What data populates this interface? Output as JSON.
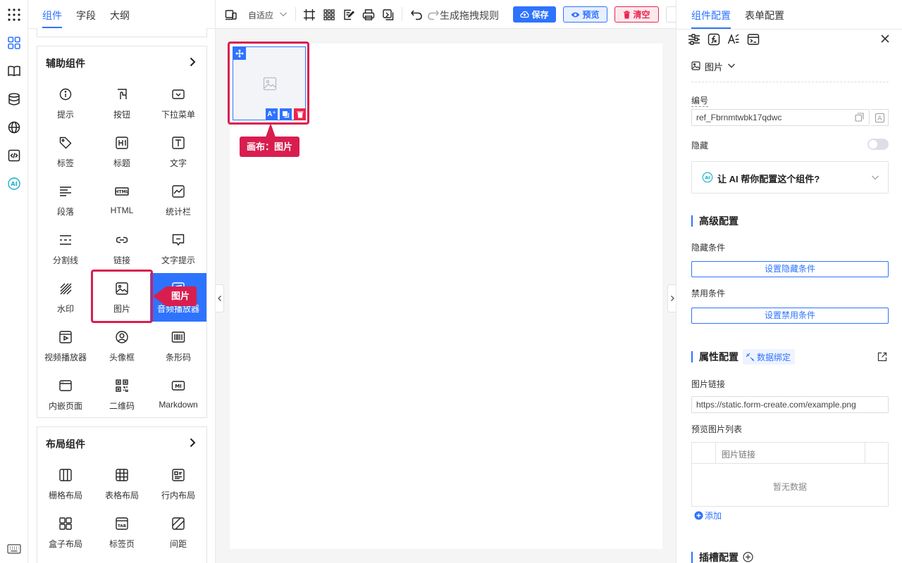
{
  "sidebar_tabs": [
    "组件",
    "字段",
    "大纲"
  ],
  "rail_icons": [
    "apps-grid-icon",
    "components-icon",
    "book-icon",
    "database-icon",
    "globe-icon",
    "code-icon",
    "ai-icon",
    "keyboard-icon"
  ],
  "aux_group": {
    "title": "辅助组件",
    "items": [
      {
        "label": "提示",
        "icon": "info-icon"
      },
      {
        "label": "按钮",
        "icon": "button-icon"
      },
      {
        "label": "下拉菜单",
        "icon": "dropdown-icon"
      },
      {
        "label": "标签",
        "icon": "tag-icon"
      },
      {
        "label": "标题",
        "icon": "heading-icon"
      },
      {
        "label": "文字",
        "icon": "text-icon"
      },
      {
        "label": "段落",
        "icon": "paragraph-icon"
      },
      {
        "label": "HTML",
        "icon": "html-icon"
      },
      {
        "label": "统计栏",
        "icon": "statistic-icon"
      },
      {
        "label": "分割线",
        "icon": "divider-icon"
      },
      {
        "label": "链接",
        "icon": "link-icon"
      },
      {
        "label": "文字提示",
        "icon": "tooltip-icon"
      },
      {
        "label": "水印",
        "icon": "watermark-icon"
      },
      {
        "label": "图片",
        "icon": "image-icon"
      },
      {
        "label": "音频播放器",
        "icon": "audio-icon"
      },
      {
        "label": "视频播放器",
        "icon": "video-icon"
      },
      {
        "label": "头像框",
        "icon": "avatar-icon"
      },
      {
        "label": "条形码",
        "icon": "barcode-icon"
      },
      {
        "label": "内嵌页面",
        "icon": "iframe-icon"
      },
      {
        "label": "二维码",
        "icon": "qrcode-icon"
      },
      {
        "label": "Markdown",
        "icon": "markdown-icon"
      }
    ]
  },
  "layout_group": {
    "title": "布局组件",
    "items": [
      {
        "label": "栅格布局",
        "icon": "grid-layout-icon"
      },
      {
        "label": "表格布局",
        "icon": "table-layout-icon"
      },
      {
        "label": "行内布局",
        "icon": "inline-layout-icon"
      },
      {
        "label": "盒子布局",
        "icon": "box-layout-icon"
      },
      {
        "label": "标签页",
        "icon": "tabs-icon"
      },
      {
        "label": "间距",
        "icon": "space-icon"
      }
    ]
  },
  "drag_hint": "图片",
  "toolbar": {
    "device": "自适应",
    "generate_rule": "生成拖拽规则",
    "save": "保存",
    "preview": "预览",
    "clear": "清空"
  },
  "canvas": {
    "tooltip": "画布：图片"
  },
  "right_tabs": [
    "组件配置",
    "表单配置"
  ],
  "config": {
    "component_type": "图片",
    "id_label": "编号",
    "id_value": "ref_Fbrnmtwbk17qdwc",
    "hidden_label": "隐藏",
    "ai_prompt": "让 AI 帮你配置这个组件?",
    "advanced_title": "高级配置",
    "hide_cond_label": "隐藏条件",
    "hide_cond_btn": "设置隐藏条件",
    "disable_cond_label": "禁用条件",
    "disable_cond_btn": "设置禁用条件",
    "props_title": "属性配置",
    "data_binding": "数据绑定",
    "img_link_label": "图片链接",
    "img_link_value": "https://static.form-create.com/example.png",
    "preview_list_label": "预览图片列表",
    "table_header": "图片链接",
    "empty_text": "暂无数据",
    "add_btn": "添加",
    "slot_title": "插槽配置"
  },
  "colors": {
    "accent": "#2e73ff",
    "danger": "#e8264f",
    "highlight": "#d81e4f"
  }
}
